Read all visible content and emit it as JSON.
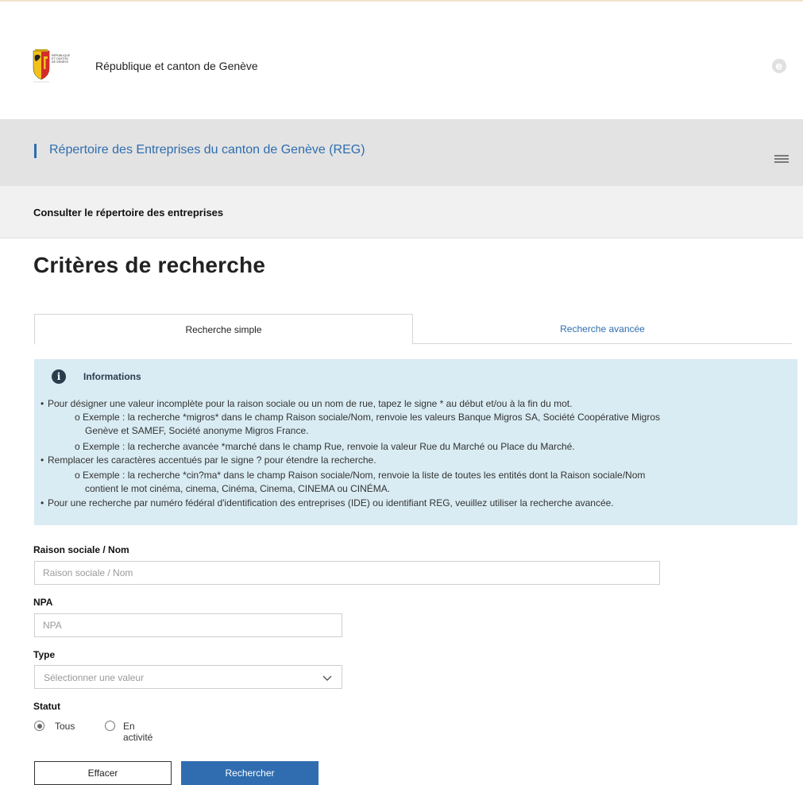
{
  "header": {
    "site_title": "République et canton de Genève",
    "logo_text": "RÉPUBLIQUE ET CANTON DE GENÈVE"
  },
  "band": {
    "title": "Répertoire des Entreprises du canton de Genève (REG)"
  },
  "subbar": {
    "title": "Consulter le répertoire des entreprises"
  },
  "page": {
    "title": "Critères de recherche"
  },
  "tabs": [
    {
      "label": "Recherche simple",
      "active": true
    },
    {
      "label": "Recherche avancée",
      "active": false
    }
  ],
  "info": {
    "icon_glyph": "i",
    "heading": "Informations",
    "lines": [
      "Pour désigner une valeur incomplète pour la raison sociale ou un nom de rue, tapez le signe * au début et/ou à la fin du mot.",
      "o Exemple : la recherche *migros* dans le champ Raison sociale/Nom, renvoie les valeurs Banque Migros SA, Société Coopérative Migros",
      "Genève et SAMEF, Société anonyme Migros France.",
      "o Exemple : la recherche avancée *marché dans le champ Rue, renvoie la valeur Rue du Marché ou Place du Marché.",
      "Remplacer les caractères accentués par le signe ? pour étendre la recherche.",
      "o Exemple : la recherche *cin?ma* dans le champ Raison sociale/Nom, renvoie la liste de toutes les entités dont la Raison sociale/Nom",
      "contient le mot cinéma, cinema, Cinéma, Cinema, CINEMA ou CINÉMA.",
      "Pour une recherche par numéro fédéral d'identification des entreprises (IDE) ou identifiant REG, veuillez utiliser la recherche avancée."
    ]
  },
  "form": {
    "raison_label": "Raison sociale / Nom",
    "raison_placeholder": "Raison sociale / Nom",
    "npa_label": "NPA",
    "npa_placeholder": "NPA",
    "type_label": "Type",
    "type_value": "Sélectionner une valeur",
    "statut_label": "Statut",
    "statut_options": [
      {
        "label": "Tous",
        "checked": true
      },
      {
        "label": "En activité",
        "checked": false
      }
    ]
  },
  "buttons": {
    "clear": "Effacer",
    "search": "Rechercher"
  },
  "colors": {
    "accent": "#2f6db0",
    "info_bg": "#d9ecf3",
    "band_bg": "#e3e3e3"
  }
}
